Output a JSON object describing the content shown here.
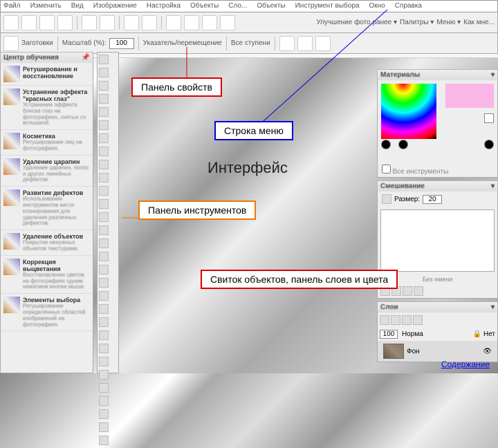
{
  "menu": [
    "Файл",
    "Изменить",
    "Вид",
    "Изображение",
    "Настройка",
    "Объекты",
    "Сло...",
    "Объекты",
    "Инструмент выбора",
    "Окно",
    "Справка"
  ],
  "toolbar": {
    "presets": "Заготовки",
    "zoom_label": "Масштаб (%):",
    "zoom_value": "100",
    "use_prev": "Указатель/перемещение",
    "all_steps": "Все ступени",
    "enhance": "Улучшение фото ранее ▾",
    "palette": "Палитры ▾",
    "menus": "Меню ▾",
    "more": "Как мне..."
  },
  "left": {
    "title": "Центр обучения",
    "items": [
      {
        "t": "Ретуширование и восстановление",
        "d": ""
      },
      {
        "t": "Устранение эффекта \"красных глаз\"",
        "d": "Устранение эффекта блеска глаз на фотографиях, снятых со вспышкой."
      },
      {
        "t": "Косметика",
        "d": "Ретуширование лиц на фотографиях."
      },
      {
        "t": "Удаление царапин",
        "d": "Удаление царапин, полос и других линейных дефектов."
      },
      {
        "t": "Развитие дефектов",
        "d": "Использование инструментов кисти клонирования для удаления различных дефектов."
      },
      {
        "t": "Удаление объектов",
        "d": "Покрытие ненужных объектов текстурами."
      },
      {
        "t": "Коррекция выцветания",
        "d": "Восстановление цветов на фотографиях одним нажатием кнопки мыши."
      },
      {
        "t": "Элементы выбора",
        "d": "Ретуширование определённых областей изображений на фотографиях."
      }
    ]
  },
  "right": {
    "materials": "Материалы",
    "all_tools": "Все инструменты",
    "mix": "Смешивание",
    "size": "Размер:",
    "size_val": "20",
    "untitled": "Без имени",
    "layers": "Слои",
    "opacity": "100",
    "mode": "Норма",
    "lock": "Нет",
    "bg": "Фон"
  },
  "labels": {
    "props": "Панель свойств",
    "menu_row": "Строка меню",
    "interface": "Интерфейс",
    "tools": "Панель инструментов",
    "scroll": "Свиток объектов, панель слоев и цвета",
    "contents": "Содержание"
  }
}
